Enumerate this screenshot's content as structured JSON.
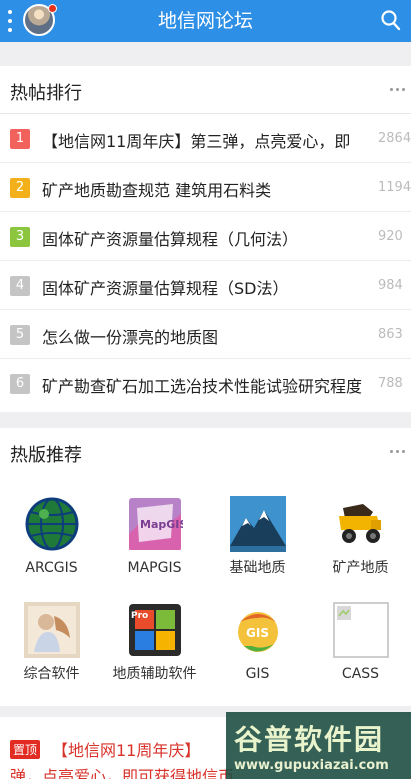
{
  "header": {
    "title": "地信网论坛"
  },
  "hot_posts": {
    "title": "热帖排行",
    "items": [
      {
        "rank": "1",
        "title": "【地信网11周年庆】第三弹，点亮爱心，即",
        "count": "2864",
        "color": "#f1625c"
      },
      {
        "rank": "2",
        "title": "矿产地质勘查规范 建筑用石料类",
        "count": "1194",
        "color": "#f4b01a"
      },
      {
        "rank": "3",
        "title": "固体矿产资源量估算规程（几何法）",
        "count": "920",
        "color": "#8cc63f"
      },
      {
        "rank": "4",
        "title": "固体矿产资源量估算规程（SD法）",
        "count": "984",
        "color": "#c5c5c5"
      },
      {
        "rank": "5",
        "title": "怎么做一份漂亮的地质图",
        "count": "863",
        "color": "#c5c5c5"
      },
      {
        "rank": "6",
        "title": "矿产勘查矿石加工选冶技术性能试验研究程度",
        "count": "788",
        "color": "#c5c5c5"
      }
    ]
  },
  "hot_forums": {
    "title": "热版推荐",
    "items": [
      {
        "label": "ARCGIS",
        "icon": "globe-icon"
      },
      {
        "label": "MAPGIS",
        "icon": "mapgis-icon"
      },
      {
        "label": "基础地质",
        "icon": "mountain-icon"
      },
      {
        "label": "矿产地质",
        "icon": "mining-truck-icon"
      },
      {
        "label": "综合软件",
        "icon": "photo-icon"
      },
      {
        "label": "地质辅助软件",
        "icon": "office-icon"
      },
      {
        "label": "GIS",
        "icon": "gis-logo-icon"
      },
      {
        "label": "CASS",
        "icon": "broken-image-icon"
      }
    ]
  },
  "sticky": {
    "badge": "置顶",
    "title": "【地信网11周年庆】",
    "line2": "弹，点亮爱心，即可获得地信币"
  },
  "watermark": {
    "main": "谷普软件园",
    "url": "www.gupuxiazai.com"
  }
}
